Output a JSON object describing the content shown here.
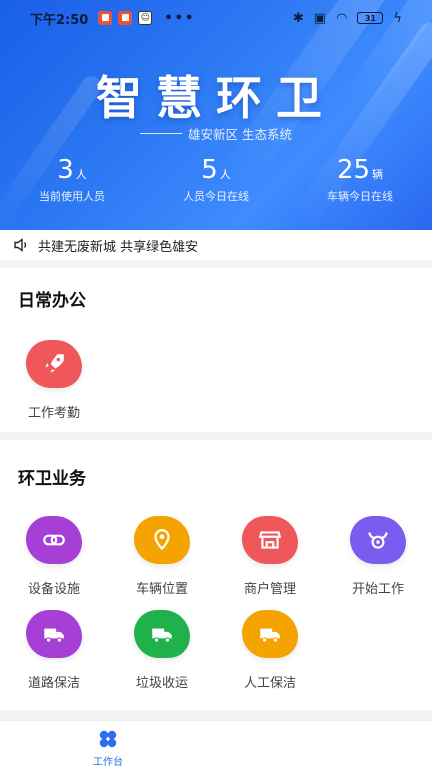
{
  "status_bar": {
    "time": "下午2:50",
    "dots": "•••",
    "battery": "31"
  },
  "hero": {
    "title": "智慧环卫",
    "subtitle": "雄安新区 生态系统",
    "stats": [
      {
        "value": "3",
        "unit": "人",
        "label": "当前使用人员"
      },
      {
        "value": "5",
        "unit": "人",
        "label": "人员今日在线"
      },
      {
        "value": "25",
        "unit": "辆",
        "label": "车辆今日在线"
      }
    ]
  },
  "notice": {
    "text": "共建无废新城 共享绿色雄安"
  },
  "daily_office": {
    "title": "日常办公",
    "items": [
      {
        "label": "工作考勤",
        "icon": "rocket-icon",
        "color": "#f0575a"
      }
    ]
  },
  "sanitation": {
    "title": "环卫业务",
    "items": [
      {
        "label": "设备设施",
        "icon": "link-icon",
        "color": "#a53fd6"
      },
      {
        "label": "车辆位置",
        "icon": "location-icon",
        "color": "#f5a300"
      },
      {
        "label": "商户管理",
        "icon": "store-icon",
        "color": "#f0575a"
      },
      {
        "label": "开始工作",
        "icon": "bull-icon",
        "color": "#7b5cf0"
      },
      {
        "label": "道路保洁",
        "icon": "truck-icon",
        "color": "#a53fd6"
      },
      {
        "label": "垃圾收运",
        "icon": "truck-icon",
        "color": "#1fb24a"
      },
      {
        "label": "人工保洁",
        "icon": "truck-icon",
        "color": "#f5a300"
      }
    ]
  },
  "tabbar": {
    "tabs": [
      {
        "label": "工作台",
        "icon": "clover-icon",
        "active": true
      }
    ]
  }
}
